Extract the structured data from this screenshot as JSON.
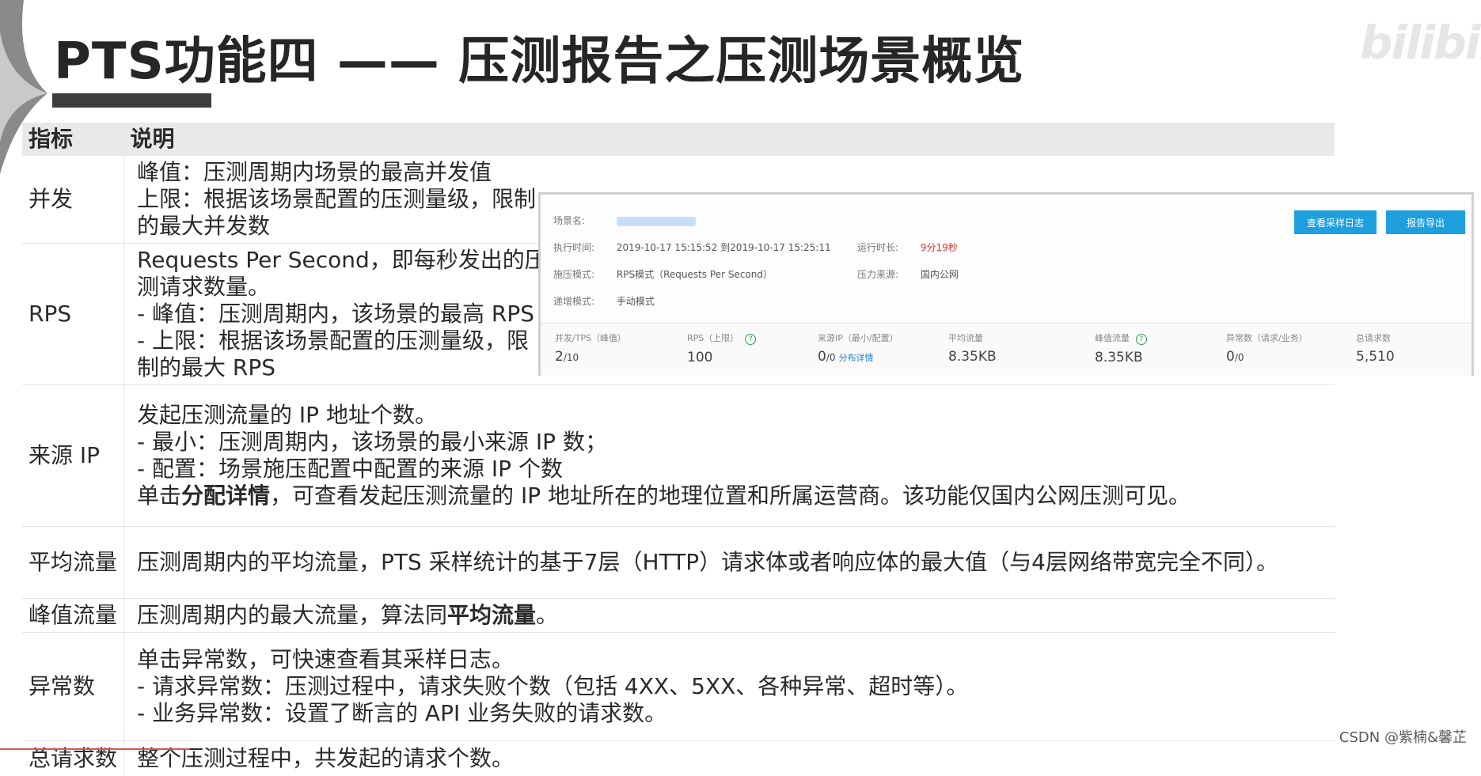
{
  "title": "PTS功能四 —— 压测报告之压测场景概览",
  "table": {
    "headers": [
      "指标",
      "说明"
    ],
    "rows": {
      "concurrency": {
        "key": "并发",
        "lines": [
          "峰值：压测周期内场景的最高并发值",
          "上限：根据该场景配置的压测量级，限制的最大并发数"
        ]
      },
      "rps": {
        "key": "RPS",
        "lines": [
          "Requests Per Second，即每秒发出的压测请求数量。",
          "- 峰值：压测周期内，该场景的最高 RPS",
          "- 上限：根据该场景配置的压测量级，限制的最大 RPS"
        ]
      },
      "source_ip": {
        "key": "来源 IP",
        "lines": [
          "发起压测流量的 IP 地址个数。",
          "- 最小：压测周期内，该场景的最小来源 IP 数；",
          "- 配置：场景施压配置中配置的来源 IP 个数"
        ],
        "last_prefix": "单击",
        "last_bold": "分配详情",
        "last_suffix": "，可查看发起压测流量的 IP 地址所在的地理位置和所属运营商。该功能仅国内公网压测可见。"
      },
      "avg_traffic": {
        "key": "平均流量",
        "text": "压测周期内的平均流量，PTS 采样统计的基于7层（HTTP）请求体或者响应体的最大值（与4层网络带宽完全不同）。"
      },
      "peak_traffic": {
        "key": "峰值流量",
        "prefix": "压测周期内的最大流量，算法同",
        "bold": "平均流量",
        "suffix": "。"
      },
      "errors": {
        "key": "异常数",
        "lines": [
          "单击异常数，可快速查看其采样日志。",
          "- 请求异常数：压测过程中，请求失败个数（包括 4XX、5XX、各种异常、超时等）。",
          "- 业务异常数：设置了断言的 API 业务失败的请求数。"
        ]
      },
      "total": {
        "key": "总请求数",
        "text": "整个压测过程中，共发起的请求个数。"
      }
    }
  },
  "panel": {
    "scene_label": "场景名:",
    "exec_time_label": "执行时间:",
    "exec_time_value": "2019-10-17 15:15:52 到2019-10-17 15:25:11",
    "duration_label": "运行时长:",
    "duration_value": "9分19秒",
    "mode_label": "施压模式:",
    "mode_value": "RPS模式（Requests Per Second）",
    "source_label": "压力来源:",
    "source_value": "国内公网",
    "ramp_label": "递增模式:",
    "ramp_value": "手动模式",
    "btn_sample_log": "查看采样日志",
    "btn_export": "报告导出",
    "stats": [
      {
        "label": "并发/TPS（峰值）",
        "main": "2",
        "sub": "/10"
      },
      {
        "label": "RPS（上限）",
        "main": "100",
        "sub": ""
      },
      {
        "label": "来源IP（最小/配置）",
        "main": "0",
        "sub": "/0",
        "link": "分布详情"
      },
      {
        "label": "平均流量",
        "main": "8.35KB",
        "sub": ""
      },
      {
        "label": "峰值流量",
        "main": "8.35KB",
        "sub": ""
      },
      {
        "label": "异常数（请求/业务）",
        "main": "0",
        "sub": "/0"
      },
      {
        "label": "总请求数",
        "main": "5,510",
        "sub": ""
      }
    ]
  },
  "brand": "bilibili",
  "watermark": "CSDN @紫楠&馨芷",
  "colors": {
    "button": "#1ea0e0",
    "duration": "#e0332b",
    "header_bg": "#e9e9e9"
  }
}
